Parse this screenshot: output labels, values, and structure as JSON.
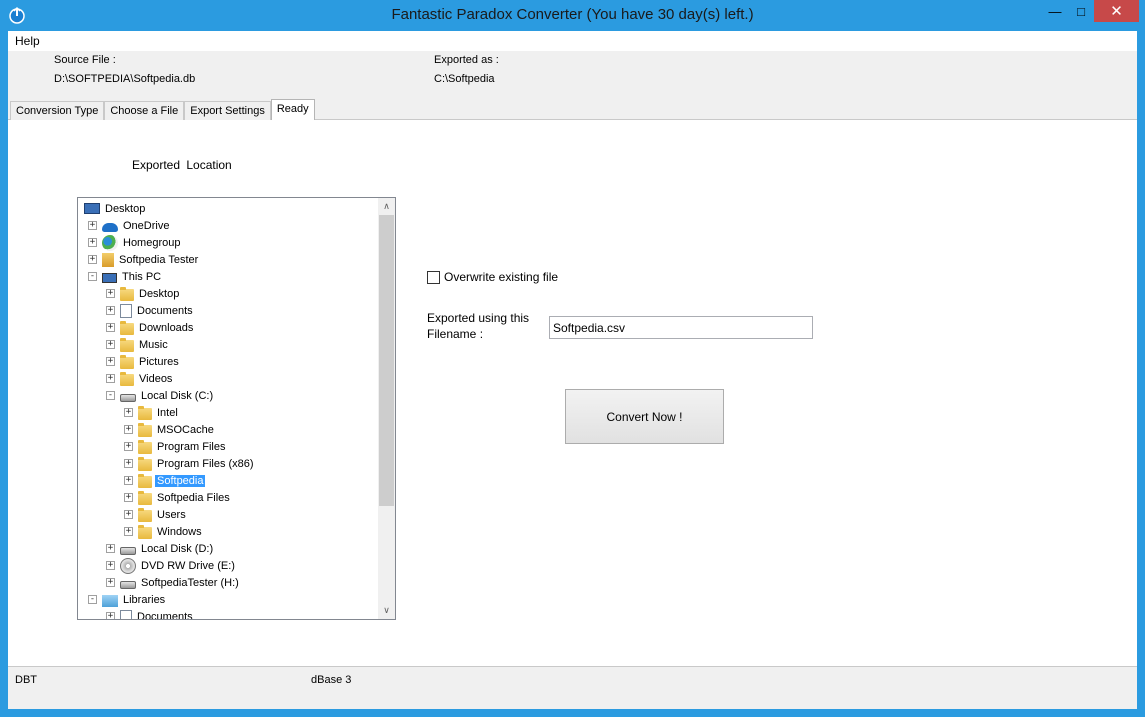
{
  "window": {
    "title": "Fantastic Paradox Converter  (You have 30 day(s) left.)",
    "minimize_glyph": "—",
    "maximize_glyph": "□",
    "close_glyph": "✕"
  },
  "menu": {
    "help": "Help"
  },
  "info": {
    "source_label": "Source File :",
    "source_value": "D:\\SOFTPEDIA\\Softpedia.db",
    "exported_label": "Exported as :",
    "exported_value": "C:\\Softpedia"
  },
  "tabs": [
    {
      "label": "Conversion Type"
    },
    {
      "label": "Choose a File"
    },
    {
      "label": "Export Settings"
    },
    {
      "label": "Ready"
    }
  ],
  "panel": {
    "export_location_label": "Exported  Location",
    "overwrite_label": "Overwrite existing file",
    "overwrite_checked": false,
    "filename_label": "Exported using this Filename :",
    "filename_value": "Softpedia.csv",
    "convert_label": "Convert Now !"
  },
  "tree": {
    "nodes": [
      {
        "label": "Desktop",
        "icon": "desktop-icon",
        "expander": ""
      },
      {
        "label": "OneDrive",
        "icon": "onedrive-icon",
        "expander": "+"
      },
      {
        "label": "Homegroup",
        "icon": "homegroup-icon",
        "expander": "+"
      },
      {
        "label": "Softpedia Tester",
        "icon": "user-folder-icon",
        "expander": "+"
      },
      {
        "label": "This PC",
        "icon": "computer-icon",
        "expander": "-"
      },
      {
        "label": "Desktop",
        "icon": "folder-icon",
        "expander": "+"
      },
      {
        "label": "Documents",
        "icon": "documents-icon",
        "expander": "+"
      },
      {
        "label": "Downloads",
        "icon": "downloads-icon",
        "expander": "+"
      },
      {
        "label": "Music",
        "icon": "music-icon",
        "expander": "+"
      },
      {
        "label": "Pictures",
        "icon": "pictures-icon",
        "expander": "+"
      },
      {
        "label": "Videos",
        "icon": "videos-icon",
        "expander": "+"
      },
      {
        "label": "Local Disk (C:)",
        "icon": "system-disk-icon",
        "expander": "-"
      },
      {
        "label": "Intel",
        "icon": "folder-icon",
        "expander": "+"
      },
      {
        "label": "MSOCache",
        "icon": "folder-icon",
        "expander": "+"
      },
      {
        "label": "Program Files",
        "icon": "folder-icon",
        "expander": "+"
      },
      {
        "label": "Program Files (x86)",
        "icon": "folder-icon",
        "expander": "+"
      },
      {
        "label": "Softpedia",
        "icon": "folder-open-icon",
        "expander": "+",
        "selected": true
      },
      {
        "label": "Softpedia Files",
        "icon": "folder-icon",
        "expander": "+"
      },
      {
        "label": "Users",
        "icon": "folder-icon",
        "expander": "+"
      },
      {
        "label": "Windows",
        "icon": "folder-icon",
        "expander": "+"
      },
      {
        "label": "Local Disk (D:)",
        "icon": "disk-icon",
        "expander": "+"
      },
      {
        "label": "DVD RW Drive (E:)",
        "icon": "dvd-drive-icon",
        "expander": "+"
      },
      {
        "label": "SoftpediaTester (H:)",
        "icon": "network-drive-icon",
        "expander": "+"
      },
      {
        "label": "Libraries",
        "icon": "libraries-icon",
        "expander": "-"
      },
      {
        "label": "Documents",
        "icon": "documents-icon",
        "expander": "+"
      }
    ],
    "scroll_up_glyph": "∧",
    "scroll_down_glyph": "∨"
  },
  "status": {
    "left": "DBT",
    "middle": "dBase 3"
  },
  "colors": {
    "titlebar": "#2b9be0",
    "close_button": "#c74949",
    "selection": "#3399ff"
  }
}
